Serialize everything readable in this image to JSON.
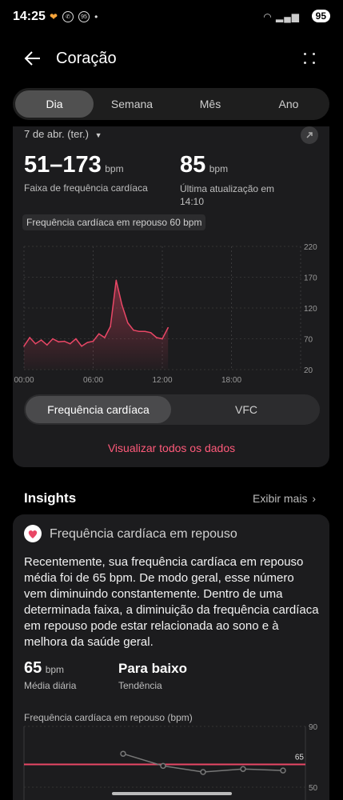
{
  "status": {
    "time": "14:25",
    "notif_badge": "95",
    "battery": "95"
  },
  "header": {
    "title": "Coração"
  },
  "tabs": [
    "Dia",
    "Semana",
    "Mês",
    "Ano"
  ],
  "summary": {
    "date": "7 de abr. (ter.)",
    "range_value": "51–173",
    "range_unit": "bpm",
    "range_label": "Faixa de frequência cardíaca",
    "last_value": "85",
    "last_unit": "bpm",
    "last_label": "Última atualização em 14:10",
    "resting_pill": "Frequência cardíaca em repouso 60 bpm"
  },
  "chart_data": [
    {
      "type": "area",
      "x": [
        "00:00",
        "00:30",
        "01:00",
        "01:30",
        "02:00",
        "02:30",
        "03:00",
        "03:30",
        "04:00",
        "04:30",
        "05:00",
        "05:30",
        "06:00",
        "06:30",
        "07:00",
        "07:30",
        "08:00",
        "08:30",
        "09:00",
        "09:30",
        "10:00",
        "10:30",
        "11:00",
        "11:30",
        "12:00",
        "12:30"
      ],
      "values": [
        58,
        72,
        62,
        68,
        60,
        70,
        65,
        66,
        62,
        70,
        58,
        64,
        66,
        78,
        72,
        90,
        165,
        125,
        96,
        84,
        82,
        82,
        80,
        72,
        70,
        88
      ],
      "x_ticks": [
        "00:00",
        "06:00",
        "12:00",
        "18:00"
      ],
      "y_ticks": [
        "220",
        "170",
        "120",
        "70",
        "20"
      ],
      "ylim": [
        20,
        220
      ],
      "color": "#e94766"
    },
    {
      "type": "line",
      "title": "Frequência cardíaca em repouso (bpm)",
      "values": [
        72,
        64,
        60,
        62,
        61
      ],
      "reference_value": 65,
      "reference_label": "65",
      "y_ticks": [
        "90",
        "50"
      ],
      "ylim": [
        50,
        90
      ],
      "line_color": "#777777",
      "reference_color": "#e94766"
    }
  ],
  "segments": {
    "active": "Frequência cardíaca",
    "inactive": "VFC"
  },
  "view_all": "Visualizar todos os dados",
  "insights": {
    "title": "Insights",
    "more": "Exibir mais",
    "card_title": "Frequência cardíaca em repouso",
    "body": "Recentemente, sua frequência cardíaca em repouso média foi de 65 bpm. De modo geral, esse número vem diminuindo constantemente. Dentro de uma determinada faixa, a diminuição da frequência cardíaca em repouso pode estar relacionada ao sono e à melhora da saúde geral.",
    "avg_value": "65",
    "avg_unit": "bpm",
    "avg_label": "Média diária",
    "trend_value": "Para baixo",
    "trend_label": "Tendência"
  }
}
